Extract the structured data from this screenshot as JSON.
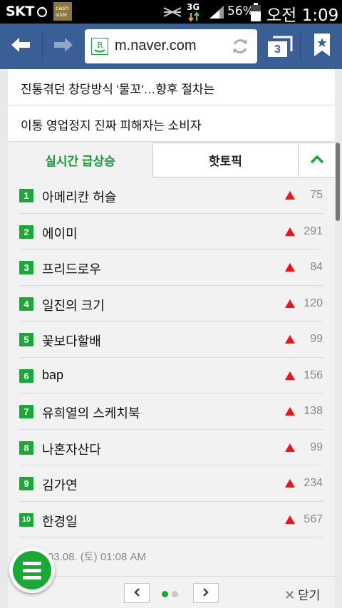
{
  "status_bar": {
    "carrier": "SKT",
    "network": "3G",
    "battery_percent": "56%",
    "time": "오전 1:09",
    "icons": [
      "cash-slide-icon",
      "mute-icon",
      "data-arrows-icon",
      "signal-icon",
      "battery-icon"
    ]
  },
  "browser": {
    "url": "m.naver.com",
    "tab_count": "3",
    "icons": [
      "back-arrow-icon",
      "forward-arrow-icon",
      "naver-favicon-icon",
      "reload-icon",
      "tabs-icon",
      "bookmark-star-icon"
    ]
  },
  "news": [
    {
      "title": "진통겪던 창당방식 '물꼬'…향후 절차는"
    },
    {
      "title": "이통 영업정지 진짜 피해자는 소비자"
    }
  ],
  "tabs": {
    "active": "실시간 급상승",
    "inactive": "핫토픽",
    "toggle_icon": "chevron-up-icon"
  },
  "trending": [
    {
      "rank": "1",
      "keyword": "아메리칸 허슬",
      "change": "75"
    },
    {
      "rank": "2",
      "keyword": "에이미",
      "change": "291"
    },
    {
      "rank": "3",
      "keyword": "프리드로우",
      "change": "84"
    },
    {
      "rank": "4",
      "keyword": "일진의 크기",
      "change": "120"
    },
    {
      "rank": "5",
      "keyword": "꽃보다할배",
      "change": "99"
    },
    {
      "rank": "6",
      "keyword": "bap",
      "change": "156"
    },
    {
      "rank": "7",
      "keyword": "유희열의 스케치북",
      "change": "138"
    },
    {
      "rank": "8",
      "keyword": "나혼자산다",
      "change": "99"
    },
    {
      "rank": "9",
      "keyword": "김가연",
      "change": "234"
    },
    {
      "rank": "10",
      "keyword": "한경일",
      "change": "567"
    }
  ],
  "timestamp": "03.08. (토) 01:08 AM",
  "pagination": {
    "prev_icon": "chevron-left-icon",
    "next_icon": "chevron-right-icon",
    "pages": 2,
    "current": 1
  },
  "close_label": "닫기",
  "colors": {
    "accent_green": "#19a935",
    "toolbar_blue": "#3a5f96",
    "up_arrow_red": "#e8171d"
  }
}
